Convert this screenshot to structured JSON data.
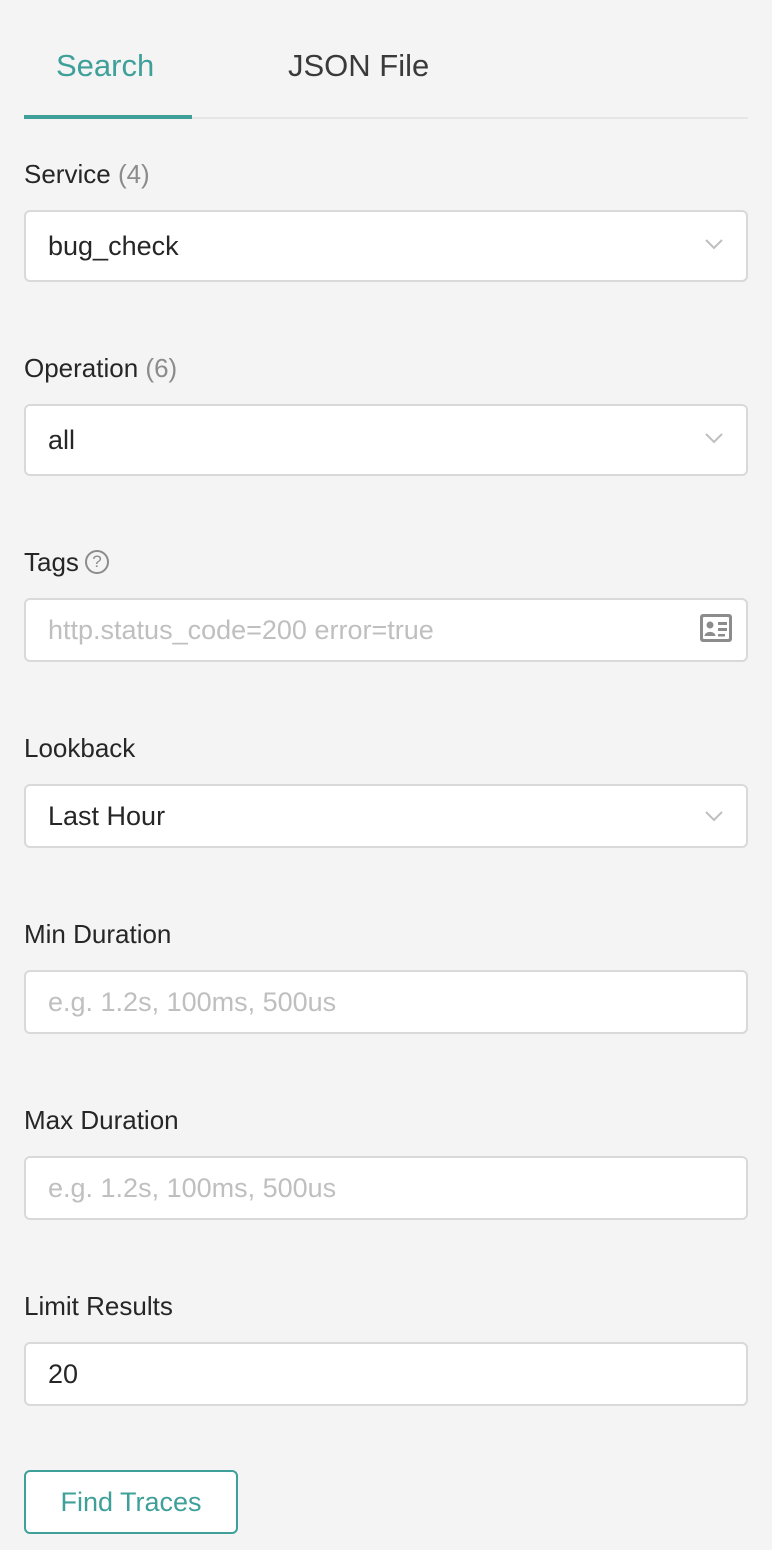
{
  "tabs": {
    "search": "Search",
    "json_file": "JSON File"
  },
  "service": {
    "label": "Service",
    "count": "(4)",
    "value": "bug_check"
  },
  "operation": {
    "label": "Operation",
    "count": "(6)",
    "value": "all"
  },
  "tags": {
    "label": "Tags",
    "help_glyph": "?",
    "placeholder": "http.status_code=200 error=true",
    "icon": "id-card-icon"
  },
  "lookback": {
    "label": "Lookback",
    "value": "Last Hour"
  },
  "min_duration": {
    "label": "Min Duration",
    "placeholder": "e.g. 1.2s, 100ms, 500us"
  },
  "max_duration": {
    "label": "Max Duration",
    "placeholder": "e.g. 1.2s, 100ms, 500us"
  },
  "limit_results": {
    "label": "Limit Results",
    "value": "20"
  },
  "find_button": "Find Traces",
  "colors": {
    "accent": "#3fa09a",
    "background": "#f4f4f4",
    "placeholder": "#bfbfbf"
  }
}
